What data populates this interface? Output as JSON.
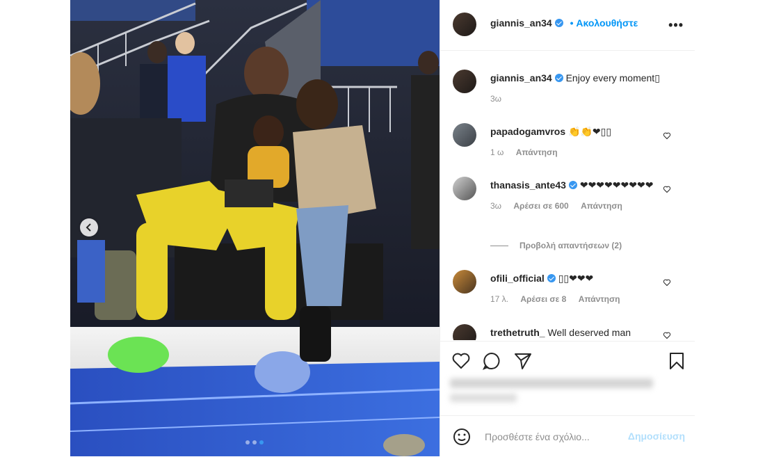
{
  "header": {
    "username": "giannis_an34",
    "follow_label": "• Ακολουθήστε",
    "more_label": "•••"
  },
  "caption": {
    "username": "giannis_an34",
    "text": "Enjoy every moment▯",
    "time": "3ω"
  },
  "comments": [
    {
      "username": "papadogamvros",
      "text": "👏👏❤▯▯",
      "time": "1 ω",
      "likes": "",
      "reply_label": "Απάντηση",
      "verified": false
    },
    {
      "username": "thanasis_ante43",
      "text": "❤❤❤❤❤❤❤❤❤",
      "time": "3ω",
      "likes": "Αρέσει σε 600",
      "reply_label": "Απάντηση",
      "verified": true
    },
    {
      "username": "ofili_official",
      "text": "▯▯❤❤❤",
      "time": "17 λ.",
      "likes": "Αρέσει σε 8",
      "reply_label": "Απάντηση",
      "verified": true
    },
    {
      "username": "trethetruth_",
      "text": "Well deserved man",
      "time": "",
      "likes": "",
      "reply_label": "",
      "verified": false
    }
  ],
  "view_replies_label": "Προβολή απαντήσεων (2)",
  "add_comment": {
    "placeholder": "Προσθέστε ένα σχόλιο...",
    "post_label": "Δημοσίευση"
  },
  "icons": {
    "like": "heart-icon",
    "comment": "comment-icon",
    "share": "paper-plane-icon",
    "save": "bookmark-icon",
    "emoji": "smiley-icon",
    "prev": "chevron-left-icon"
  },
  "colors": {
    "accent": "#0095f6",
    "post_disabled": "#b2dffc",
    "muted": "#8e8e8e",
    "verified": "#3897f0"
  }
}
